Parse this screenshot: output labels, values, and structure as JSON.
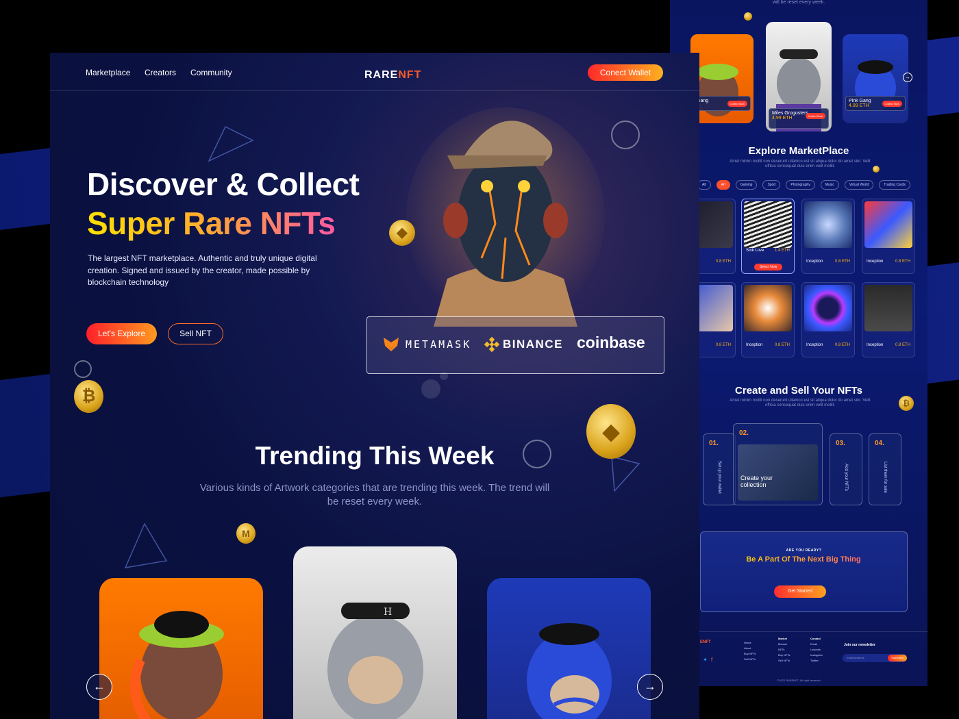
{
  "nav": {
    "links": [
      "Marketplace",
      "Creators",
      "Community"
    ],
    "logo_a": "RARE",
    "logo_b": "NFT",
    "wallet": "Conect Wallet"
  },
  "hero": {
    "title_1": "Discover & Collect",
    "title_2": "Super Rare NFTs",
    "lead": "The largest NFT marketplace. Authentic and truly unique digital creation. Signed and issued by the creator, made possible by blockchain technology",
    "explore": "Let's Explore",
    "sell": "Sell NFT"
  },
  "partners": {
    "metamask": "METAMASK",
    "binance": "BINANCE",
    "coinbase": "coinbase"
  },
  "trending": {
    "title": "Trending This Week",
    "subtitle": "Various kinds of Artwork categories that are trending this week. The trend will be reset every week."
  },
  "right": {
    "top_note": "will be reset every week.",
    "cards": [
      {
        "name": "Gang",
        "price": "ETH",
        "btn": "Collect Now"
      },
      {
        "name": "Miles Grogosters",
        "price": "4.99 ETH",
        "btn": "Collect Now"
      },
      {
        "name": "Pink Gang",
        "price": "4.99 ETH",
        "btn": "Collect Now"
      }
    ],
    "explore_title": "Explore MarketPlace",
    "explore_sub": "Amet minim mollit non deserunt ullamco est sit aliqua dolor do amet sint. Velit officia consequat duis enim velit mollit.",
    "chips": [
      "All",
      "Art",
      "Gaming",
      "Sport",
      "Photography",
      "Music",
      "Virtual World",
      "Trading Cards"
    ],
    "grid": [
      {
        "name": "on",
        "eth": "0.8 ETH"
      },
      {
        "name": "Sink Love",
        "eth": "1.4 ETH",
        "btn": "Select Now"
      },
      {
        "name": "Inception",
        "eth": "0.8 ETH"
      },
      {
        "name": "Inception",
        "eth": "0.8 ETH"
      },
      {
        "name": "on",
        "eth": "0.8 ETH"
      },
      {
        "name": "Inception",
        "eth": "0.8 ETH"
      },
      {
        "name": "Inception",
        "eth": "0.8 ETH"
      },
      {
        "name": "Inception",
        "eth": "0.8 ETH"
      }
    ],
    "create_title": "Create and Sell Your NFTs",
    "create_sub": "Amet minim mollit non deserunt ullamco est sit aliqua dolor do amet sint. Velit officia consequat duis enim velit mollit.",
    "steps": [
      {
        "no": "01.",
        "label": "Set up your wallet"
      },
      {
        "no": "02.",
        "label": "Create your collection"
      },
      {
        "no": "03.",
        "label": "Add your NFTs"
      },
      {
        "no": "04.",
        "label": "List them for sale"
      }
    ],
    "cta_eyebrow": "ARE YOU READY?",
    "cta_title": "Be A Part Of The Next Big Thing",
    "cta_button": "Get Started",
    "footer": {
      "logo": "ENFT",
      "col1": [
        "Home",
        "About",
        "Buy NFTs",
        "Sell NFTs"
      ],
      "market_head": "Market",
      "market": [
        "Browse",
        "NFTs",
        "Buy NFTs",
        "Sell NFTs"
      ],
      "contact_head": "Contact",
      "contact": [
        "Email",
        "LinkedIn",
        "Instagram",
        "Twitter"
      ],
      "newsletter_head": "Join our newsletter",
      "email_ph": "Email Address",
      "subscribe": "Subscribe",
      "copyright": "©2022 RARENFT. All right reserved"
    }
  },
  "colors": {
    "accent_red": "#ff2a2a",
    "accent_orange": "#ffb020",
    "bg_navy": "#0a1140",
    "band_blue": "#13248f"
  }
}
